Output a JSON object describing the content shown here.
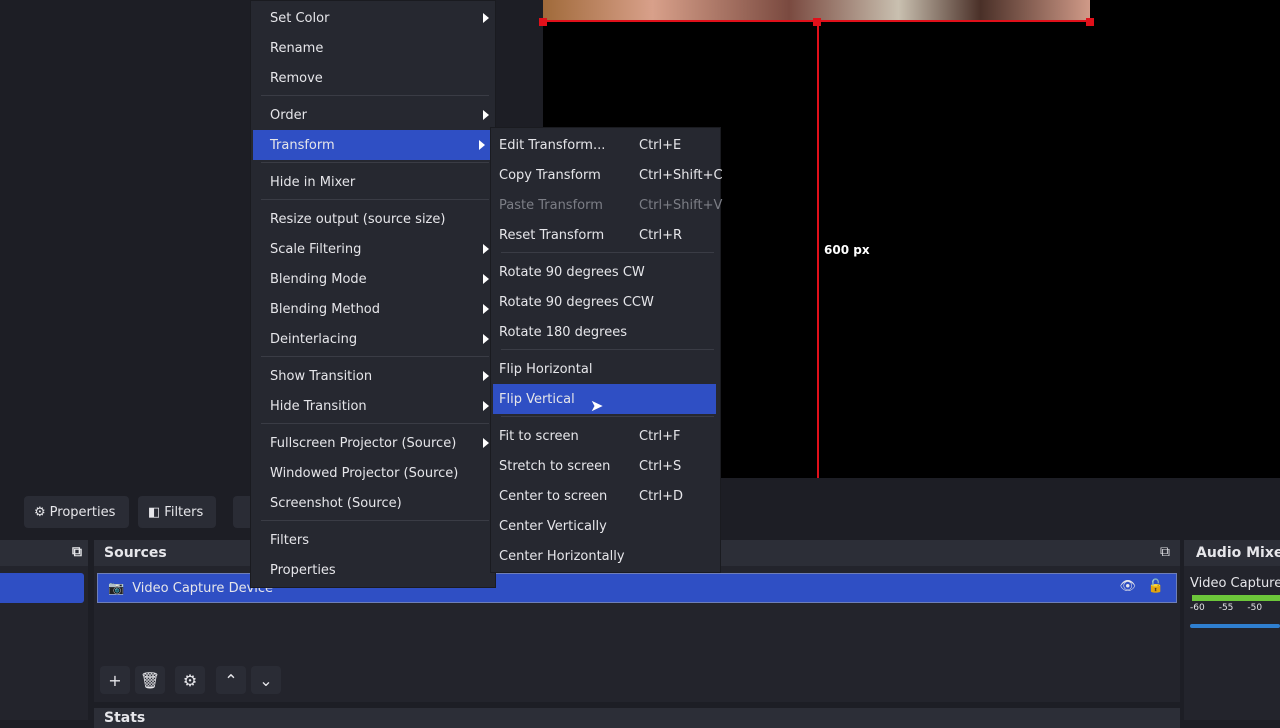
{
  "preview": {
    "measure_label": "600 px"
  },
  "toolbar": {
    "properties": "Properties",
    "filters": "Filters"
  },
  "scenes_dock": {},
  "sources": {
    "title": "Sources",
    "items": [
      {
        "name": "Video Capture Device",
        "visible": true,
        "locked": false
      }
    ]
  },
  "stats": {
    "title": "Stats"
  },
  "audio_mixer": {
    "title": "Audio Mixer",
    "channel": "Video Capture",
    "ticks": [
      "-60",
      "-55",
      "-50"
    ]
  },
  "context_menu": {
    "items": [
      {
        "label": "Set Color",
        "submenu": true
      },
      {
        "label": "Rename"
      },
      {
        "label": "Remove"
      },
      {
        "label": "Order",
        "submenu": true
      },
      {
        "label": "Transform",
        "submenu": true,
        "highlighted": true
      },
      {
        "label": "Hide in Mixer"
      },
      {
        "label": "Resize output (source size)"
      },
      {
        "label": "Scale Filtering",
        "submenu": true
      },
      {
        "label": "Blending Mode",
        "submenu": true
      },
      {
        "label": "Blending Method",
        "submenu": true
      },
      {
        "label": "Deinterlacing",
        "submenu": true
      },
      {
        "label": "Show Transition",
        "submenu": true
      },
      {
        "label": "Hide Transition",
        "submenu": true
      },
      {
        "label": "Fullscreen Projector (Source)",
        "submenu": true
      },
      {
        "label": "Windowed Projector (Source)"
      },
      {
        "label": "Screenshot (Source)"
      },
      {
        "label": "Filters"
      },
      {
        "label": "Properties"
      }
    ]
  },
  "transform_menu": {
    "items": [
      {
        "label": "Edit Transform...",
        "shortcut": "Ctrl+E"
      },
      {
        "label": "Copy Transform",
        "shortcut": "Ctrl+Shift+C"
      },
      {
        "label": "Paste Transform",
        "shortcut": "Ctrl+Shift+V",
        "disabled": true
      },
      {
        "label": "Reset Transform",
        "shortcut": "Ctrl+R"
      },
      {
        "label": "Rotate 90 degrees CW",
        "shortcut": ""
      },
      {
        "label": "Rotate 90 degrees CCW",
        "shortcut": ""
      },
      {
        "label": "Rotate 180 degrees",
        "shortcut": ""
      },
      {
        "label": "Flip Horizontal",
        "shortcut": ""
      },
      {
        "label": "Flip Vertical",
        "shortcut": "",
        "highlighted": true
      },
      {
        "label": "Fit to screen",
        "shortcut": "Ctrl+F"
      },
      {
        "label": "Stretch to screen",
        "shortcut": "Ctrl+S"
      },
      {
        "label": "Center to screen",
        "shortcut": "Ctrl+D"
      },
      {
        "label": "Center Vertically",
        "shortcut": ""
      },
      {
        "label": "Center Horizontally",
        "shortcut": ""
      }
    ]
  },
  "colors": {
    "accent": "#2f4fc4",
    "selection_outline": "#e0101a",
    "meter_green": "#6cc63a"
  }
}
